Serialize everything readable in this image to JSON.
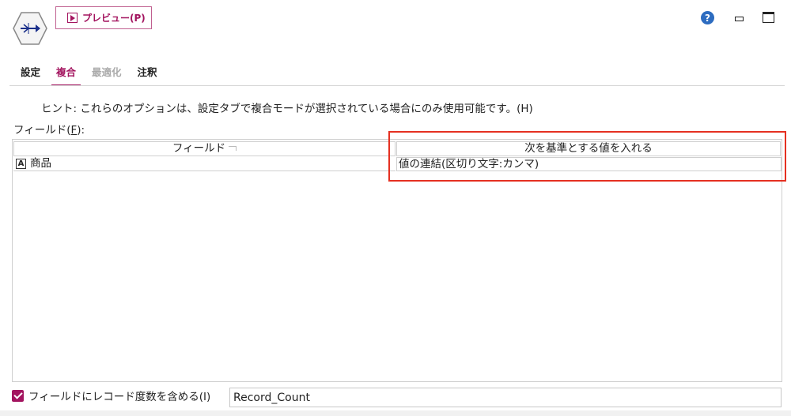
{
  "node": {
    "icon": "aggregate-node-icon"
  },
  "toolbar": {
    "preview_label": "プレビュー(P)"
  },
  "window": {
    "help_icon": "?"
  },
  "tabs": [
    {
      "label": "設定",
      "state": "normal"
    },
    {
      "label": "複合",
      "state": "active"
    },
    {
      "label": "最適化",
      "state": "disabled"
    },
    {
      "label": "注釈",
      "state": "normal"
    }
  ],
  "hint": "ヒント: これらのオプションは、設定タブで複合モードが選択されている場合にのみ使用可能です。(H)",
  "fields_label": {
    "prefix": "フィールド(",
    "key": "F",
    "suffix": "):"
  },
  "table": {
    "columns": [
      "フィールド",
      "次を基準とする値を入れる"
    ],
    "rows": [
      {
        "type_icon": "A",
        "field": "商品",
        "value": "値の連結(区切り文字:カンマ)"
      }
    ]
  },
  "footer": {
    "checkbox_checked": true,
    "checkbox_label": "フィールドにレコード度数を含める(I)",
    "record_count_value": "Record_Count"
  },
  "colors": {
    "accent": "#a3145f",
    "highlight": "#e53021",
    "help": "#2d6cc0"
  }
}
